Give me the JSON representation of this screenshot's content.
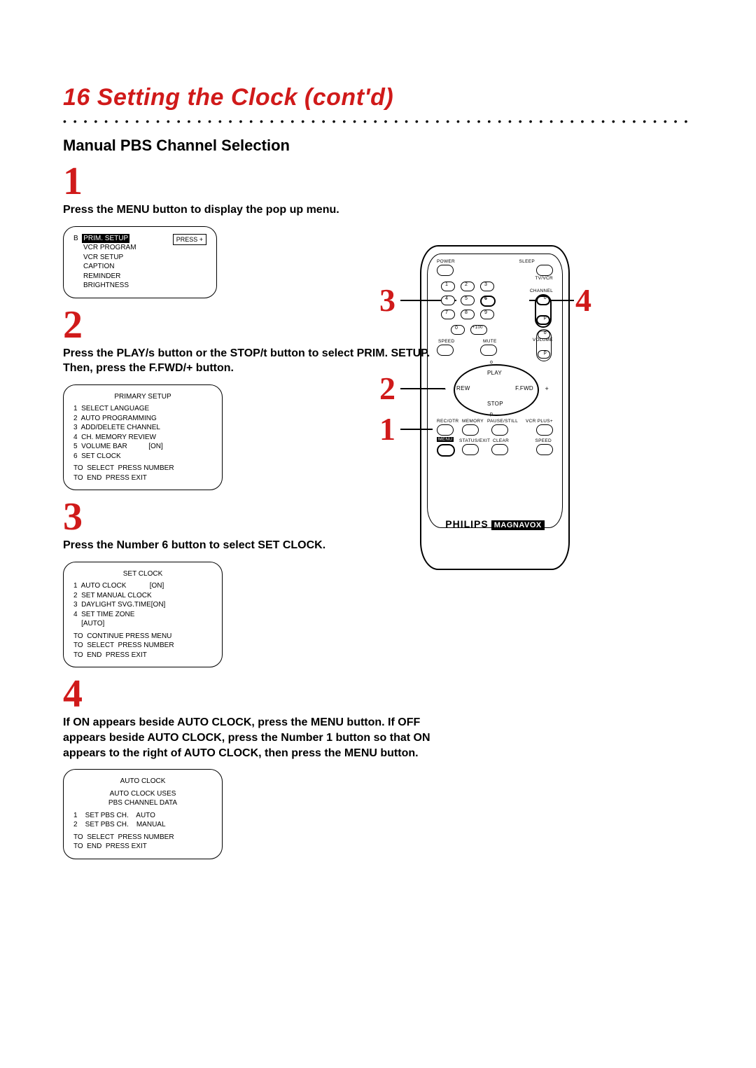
{
  "page": {
    "title_num": "16",
    "title_text": "Setting the Clock (cont'd)",
    "subtitle": "Manual PBS Channel Selection"
  },
  "steps": {
    "s1": {
      "num": "1",
      "desc": "Press the MENU button to display the pop up menu.",
      "screen": {
        "press_hint": "PRESS +",
        "row_b": "B",
        "row_prim": "PRIM. SETUP",
        "row_vcrprog": "VCR PROGRAM",
        "row_vcrsetup": "VCR SETUP",
        "row_caption": "CAPTION",
        "row_reminder": "REMINDER",
        "row_bright": "BRIGHTNESS"
      }
    },
    "s2": {
      "num": "2",
      "desc": "Press the PLAY/s  button or the STOP/t  button to select PRIM. SETUP. Then, press the F.FWD/+ button.",
      "screen": {
        "title": "PRIMARY SETUP",
        "r1": "1  SELECT LANGUAGE",
        "r2": "2  AUTO PROGRAMMING",
        "r3": "3  ADD/DELETE CHANNEL",
        "r4": "4  CH. MEMORY REVIEW",
        "r5": "5  VOLUME BAR           [ON]",
        "r6": "6  SET CLOCK",
        "f1": "TO  SELECT  PRESS NUMBER",
        "f2": "TO  END  PRESS EXIT"
      }
    },
    "s3": {
      "num": "3",
      "desc": "Press the Number 6 button to select SET CLOCK.",
      "screen": {
        "title": "SET CLOCK",
        "r1": "1  AUTO CLOCK            [ON]",
        "r2": "2  SET MANUAL CLOCK",
        "r3": "3  DAYLIGHT SVG.TIME[ON]",
        "r4": "4  SET TIME ZONE",
        "r4b": "    [AUTO]",
        "f0": "TO  CONTINUE PRESS MENU",
        "f1": "TO  SELECT  PRESS NUMBER",
        "f2": "TO  END  PRESS EXIT"
      }
    },
    "s4": {
      "num": "4",
      "desc": "If ON appears beside AUTO CLOCK, press the MENU button. If OFF appears beside AUTO CLOCK, press the Number 1 button so that ON appears to the right of AUTO CLOCK, then press the MENU button.",
      "screen": {
        "title": "AUTO CLOCK",
        "sub1": "AUTO CLOCK USES",
        "sub2": "PBS CHANNEL DATA",
        "r1": "1    SET PBS CH.    AUTO",
        "r2": "2    SET PBS CH.    MANUAL",
        "f1": "TO  SELECT  PRESS NUMBER",
        "f2": "TO  END  PRESS EXIT"
      }
    }
  },
  "remote": {
    "power": "POWER",
    "sleep": "SLEEP",
    "tvvcr": "TV/VCR",
    "channel": "CHANNEL",
    "speed": "SPEED",
    "mute": "MUTE",
    "volume": "VOLUME",
    "play": "PLAY",
    "rew": "REW",
    "ffwd": "F.FWD",
    "stop": "STOP",
    "recotr": "REC/OTR",
    "memory": "MEMORY",
    "pausestill": "PAUSE/STILL",
    "vcrplus": "VCR PLUS+",
    "menu": "MENU",
    "statusexit": "STATUS/EXIT",
    "clear": "CLEAR",
    "speed2": "SPEED",
    "keys": {
      "k1": "1",
      "k2": "2",
      "k3": "3",
      "k4": "4",
      "k5": "5",
      "k6": "6",
      "k7": "7",
      "k8": "8",
      "k9": "9",
      "k0": "0",
      "k100": "+100"
    },
    "chan_o": "o",
    "chan_p": "p",
    "vol_o": "o",
    "vol_p": "p",
    "minus": "–",
    "plus": "+",
    "tri_up": "o",
    "tri_down": "p",
    "brand": "PHILIPS",
    "brand2": "MAGNAVOX"
  },
  "callouts": {
    "c1": "1",
    "c2": "2",
    "c3": "3",
    "c4": "4"
  }
}
